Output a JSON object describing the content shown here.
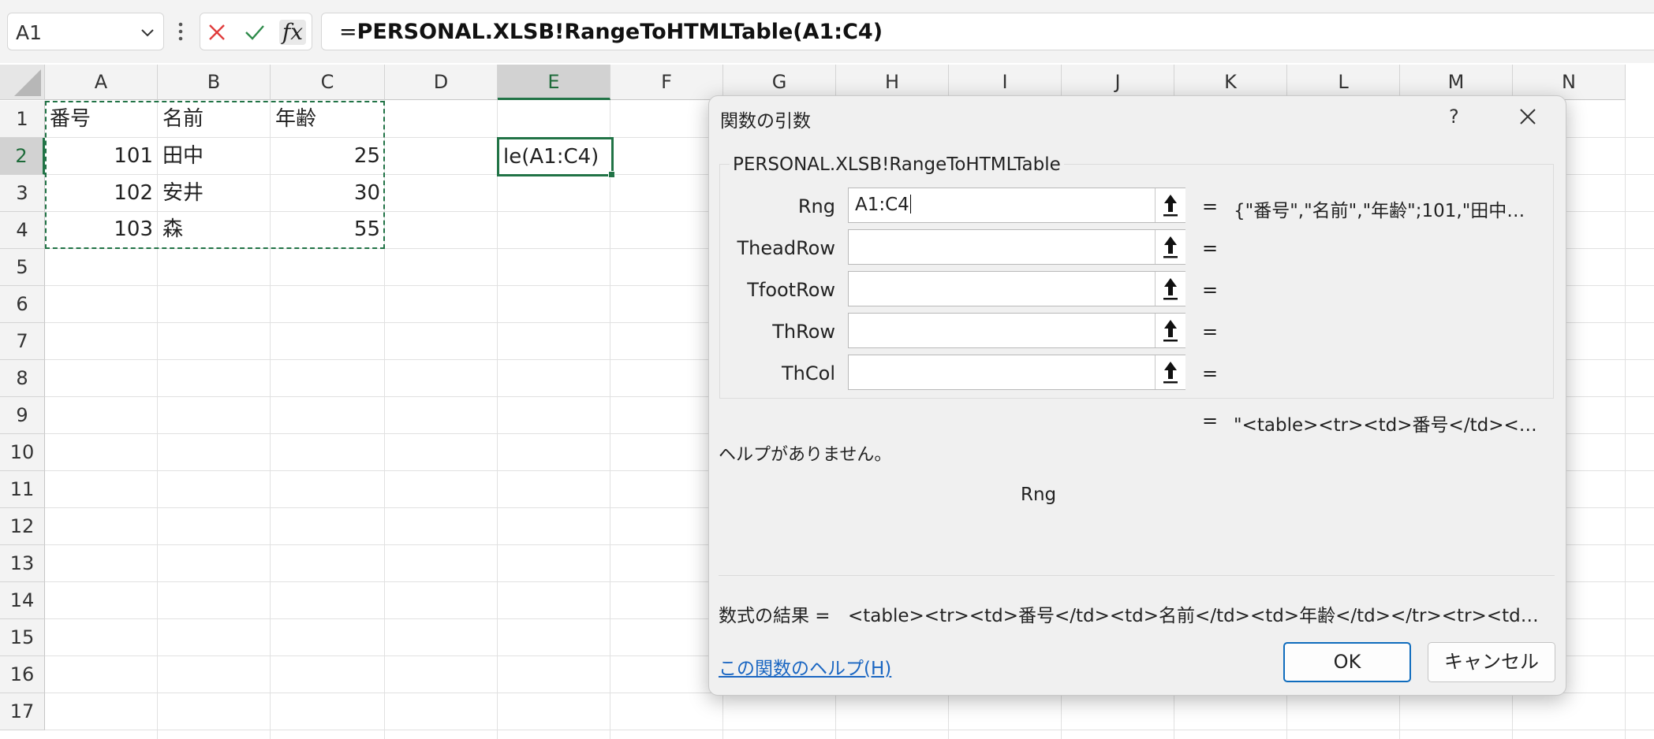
{
  "formula_bar": {
    "name_box": "A1",
    "formula_prefix": "=",
    "formula_body": "PERSONAL.XLSB!RangeToHTMLTable(A1:C4)",
    "icons": [
      "chevron-down-icon",
      "kebab-icon",
      "cancel-x-icon",
      "enter-check-icon",
      "fx-icon"
    ],
    "fx_label": "fx"
  },
  "grid": {
    "columns": [
      "A",
      "B",
      "C",
      "D",
      "E",
      "F",
      "G",
      "H",
      "I",
      "J",
      "K",
      "L",
      "M",
      "N"
    ],
    "selected_column": "E",
    "rows": [
      "1",
      "2",
      "3",
      "4",
      "5",
      "6",
      "7",
      "8",
      "9",
      "10",
      "11",
      "12",
      "13",
      "14",
      "15",
      "16",
      "17"
    ],
    "selected_row": "2",
    "cells": {
      "A1": "番号",
      "B1": "名前",
      "C1": "年齢",
      "A2": "101",
      "B2": "田中",
      "C2": "25",
      "A3": "102",
      "B3": "安井",
      "C3": "30",
      "A4": "103",
      "B4": "森",
      "C4": "55"
    },
    "active_cell_text": "le(A1:C4)",
    "colors": {
      "accent": "#217346",
      "grid": "#e1e1e1"
    }
  },
  "dialog": {
    "title": "関数の引数",
    "help_glyph": "?",
    "function_name": "PERSONAL.XLSB!RangeToHTMLTable",
    "args": [
      {
        "label": "Rng",
        "value": "A1:C4",
        "result": "{\"番号\",\"名前\",\"年齢\";101,\"田中…"
      },
      {
        "label": "TheadRow",
        "value": "",
        "result": ""
      },
      {
        "label": "TfootRow",
        "value": "",
        "result": ""
      },
      {
        "label": "ThRow",
        "value": "",
        "result": ""
      },
      {
        "label": "ThCol",
        "value": "",
        "result": ""
      }
    ],
    "equals": "=",
    "function_result_preview": "\"<table><tr><td>番号</td><…",
    "no_help": "ヘルプがありません。",
    "arg_description_name": "Rng",
    "formula_result_label": "数式の結果 =",
    "formula_result_value": "<table><tr><td>番号</td><td>名前</td><td>年齢</td></tr><tr><td…",
    "help_link": "この関数のヘルプ(H)",
    "ok_label": "OK",
    "cancel_label": "キャンセル",
    "colors": {
      "link": "#1a66c2",
      "ok_border": "#0f6cbd"
    }
  }
}
